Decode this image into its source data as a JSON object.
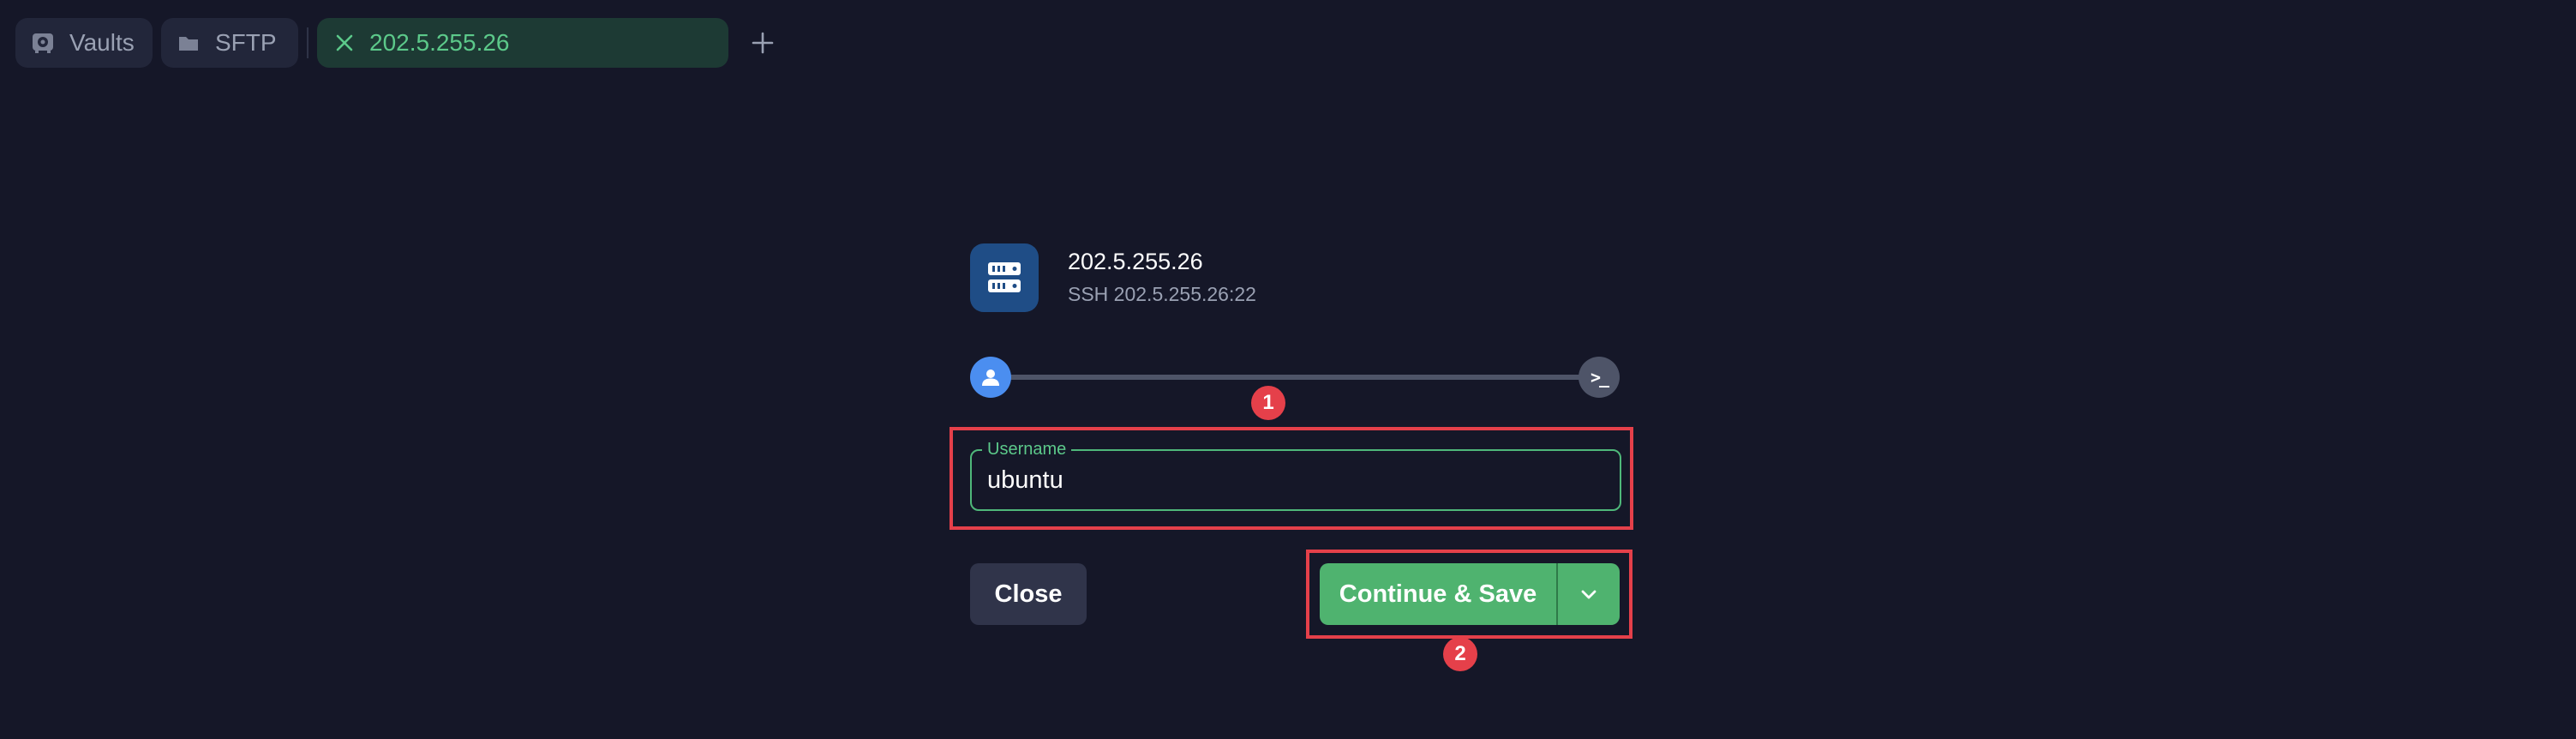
{
  "tabs": {
    "vaults_label": "Vaults",
    "sftp_label": "SFTP",
    "active_label": "202.5.255.26",
    "new_tab_icon": "plus-icon"
  },
  "host": {
    "name": "202.5.255.26",
    "subtitle": "SSH 202.5.255.26:22",
    "icon": "server-icon"
  },
  "progress": {
    "steps": [
      "user-icon",
      "terminal-icon"
    ],
    "terminal_glyph": ">_"
  },
  "username_field": {
    "label": "Username",
    "value": "ubuntu"
  },
  "buttons": {
    "close_label": "Close",
    "continue_label": "Continue & Save",
    "dropdown_icon": "chevron-down-icon"
  },
  "annotations": {
    "marker_1": "1",
    "marker_2": "2",
    "color": "#e5404a"
  },
  "colors": {
    "background": "#151728",
    "accent_green": "#4fb36f",
    "step_blue": "#4b8ef0",
    "host_icon_bg": "#1f4d86"
  }
}
